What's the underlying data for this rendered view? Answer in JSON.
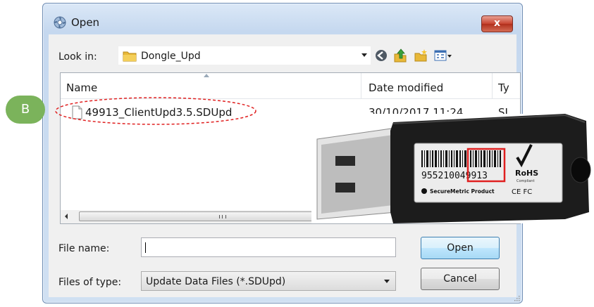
{
  "window": {
    "title": "Open",
    "close_label": "x"
  },
  "toolbar": {
    "look_in_label": "Look in:",
    "look_in_value": "Dongle_Upd",
    "icons": [
      "back-icon",
      "up-folder-icon",
      "new-folder-icon",
      "view-menu-icon"
    ]
  },
  "list": {
    "columns": {
      "name": "Name",
      "date": "Date modified",
      "type": "Ty"
    },
    "rows": [
      {
        "name": "49913_ClientUpd3.5.SDUpd",
        "date": "30/10/2017 11:24 ...",
        "type": "SI"
      }
    ],
    "scroll_grip": "III"
  },
  "form": {
    "file_name_label": "File name:",
    "file_name_value": "",
    "files_of_type_label": "Files of type:",
    "files_of_type_value": "Update Data Files (*.SDUpd)"
  },
  "buttons": {
    "open": "Open",
    "cancel": "Cancel"
  },
  "annotation": {
    "badge": "B",
    "color": "#e02020"
  },
  "dongle": {
    "barcode_digits": "955210049913",
    "highlight": "49913",
    "rohs": "RoHS",
    "rohs_sub": "Compliant",
    "brand": "SecureMetric Product",
    "marks": "CE FC"
  }
}
